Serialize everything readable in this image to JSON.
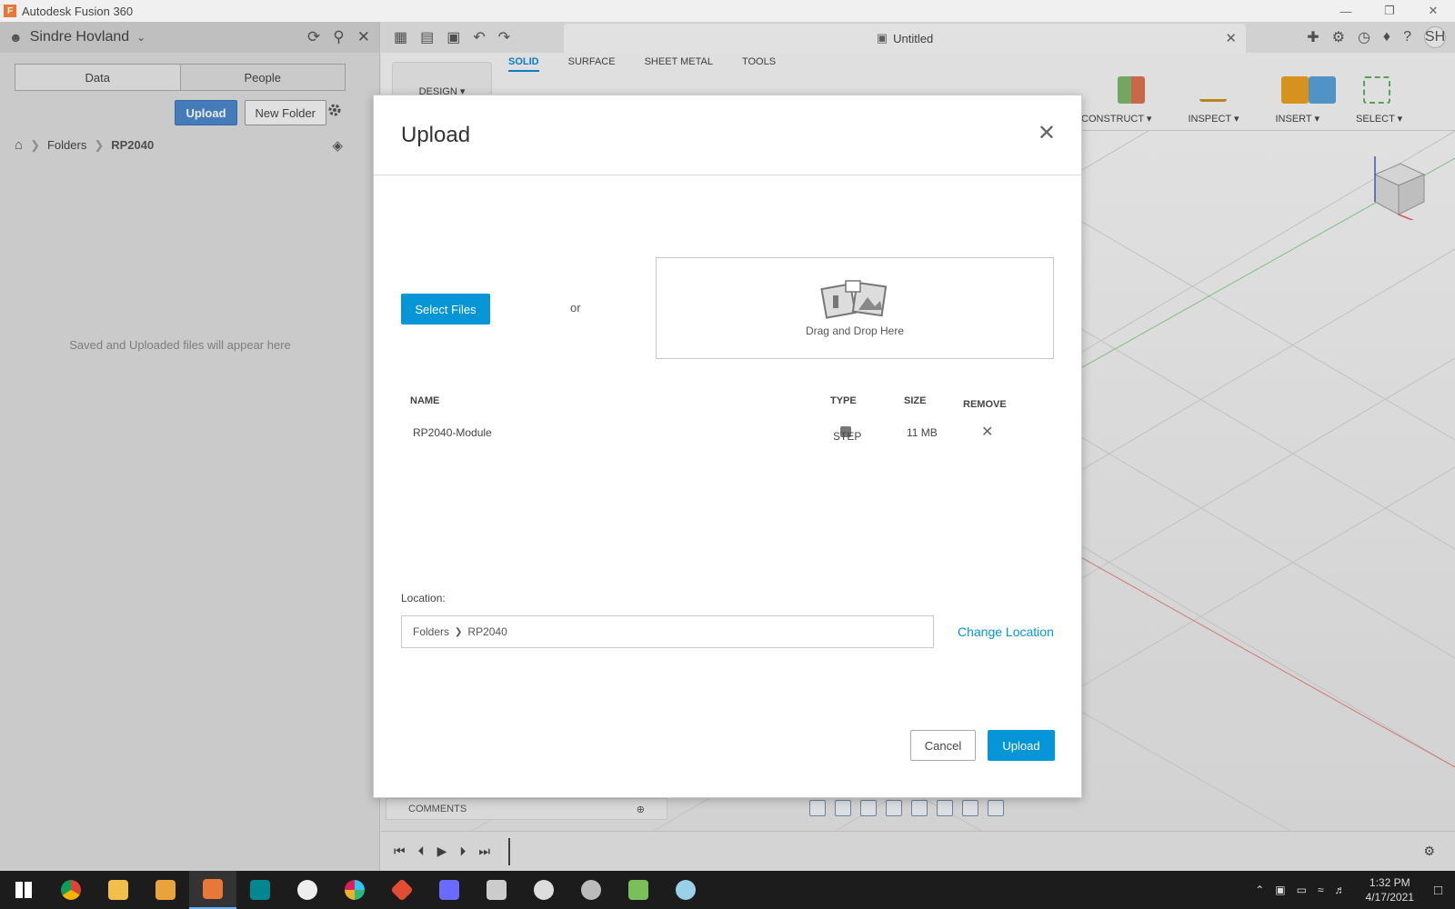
{
  "window": {
    "title": "Autodesk Fusion 360",
    "minimize": "—",
    "restore": "❐",
    "close": "✕"
  },
  "data_panel": {
    "user_name": "Sindre Hovland",
    "tabs": [
      {
        "label": "Data"
      },
      {
        "label": "People"
      }
    ],
    "upload_label": "Upload",
    "new_folder_label": "New Folder",
    "breadcrumb": {
      "folders": "Folders",
      "current": "RP2040"
    },
    "empty_message": "Saved and Uploaded files will appear here"
  },
  "document": {
    "tab_title": "Untitled",
    "avatar": "SH"
  },
  "ribbon": {
    "workspace": "DESIGN ▾",
    "tabs": [
      "SOLID",
      "SURFACE",
      "SHEET METAL",
      "TOOLS"
    ],
    "groups": [
      "CONSTRUCT ▾",
      "INSPECT ▾",
      "INSERT ▾",
      "SELECT ▾"
    ]
  },
  "bottom": {
    "comments_label": "COMMENTS"
  },
  "modal": {
    "title": "Upload",
    "select_files_label": "Select Files",
    "or_label": "or",
    "drop_label": "Drag and Drop Here",
    "columns": {
      "name": "NAME",
      "type": "TYPE",
      "size": "SIZE",
      "remove": "REMOVE"
    },
    "files": [
      {
        "name": "RP2040-Module",
        "type": "STEP",
        "size": "11 MB"
      }
    ],
    "location_label": "Location:",
    "location_path": {
      "root": "Folders",
      "sep": "❯",
      "folder": "RP2040"
    },
    "change_location_label": "Change Location",
    "cancel_label": "Cancel",
    "upload_label": "Upload"
  },
  "taskbar": {
    "time": "1:32 PM",
    "date": "4/17/2021"
  },
  "colors": {
    "accent": "#0696d7",
    "panel_upload": "#4a86c8",
    "axis_red": "#e08080",
    "axis_green": "#88d088"
  }
}
